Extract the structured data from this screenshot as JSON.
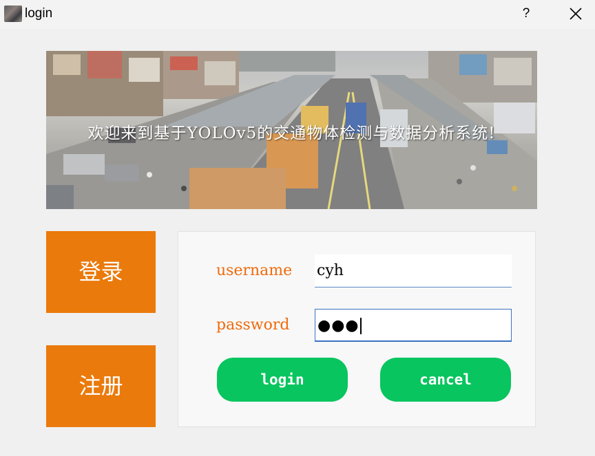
{
  "window": {
    "title": "login",
    "help_label": "?"
  },
  "banner": {
    "text": "欢迎来到基于YOLOv5的交通物体检测与数据分析系统!"
  },
  "side_buttons": {
    "login_label": "登录",
    "register_label": "注册"
  },
  "form": {
    "username_label": "username",
    "username_value": "cyh",
    "password_label": "password",
    "password_mask": "●●●",
    "login_button": "login",
    "cancel_button": "cancel"
  },
  "colors": {
    "accent_orange": "#ea7a0b",
    "label_orange": "#ef6a0b",
    "button_green": "#08c55f"
  }
}
